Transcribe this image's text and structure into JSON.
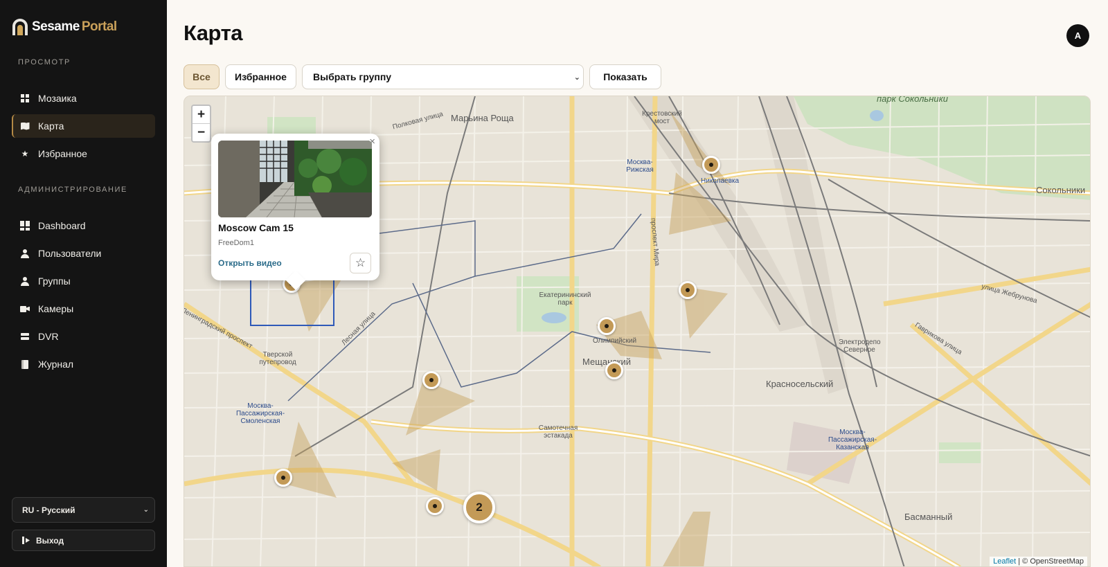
{
  "brand": {
    "name_a": "Sesame",
    "name_b": "Portal"
  },
  "sidebar": {
    "section_view": "ПРОСМОТР",
    "section_admin": "АДМИНИСТРИРОВАНИЕ",
    "view_items": [
      {
        "label": "Мозаика",
        "icon": "grid-icon"
      },
      {
        "label": "Карта",
        "icon": "map-icon",
        "active": true
      },
      {
        "label": "Избранное",
        "icon": "star-icon"
      }
    ],
    "admin_items": [
      {
        "label": "Dashboard",
        "icon": "dashboard-icon"
      },
      {
        "label": "Пользователи",
        "icon": "user-icon"
      },
      {
        "label": "Группы",
        "icon": "users-icon"
      },
      {
        "label": "Камеры",
        "icon": "camera-icon"
      },
      {
        "label": "DVR",
        "icon": "dvr-icon"
      },
      {
        "label": "Журнал",
        "icon": "journal-icon"
      }
    ],
    "language": "RU - Русский",
    "logout": "Выход"
  },
  "header": {
    "title": "Карта",
    "avatar_initial": "A"
  },
  "toolbar": {
    "all_label": "Все",
    "favorites_label": "Избранное",
    "group_select": "Выбрать группу",
    "show_label": "Показать"
  },
  "map": {
    "zoom_in": "+",
    "zoom_out": "−",
    "cluster_count": "2",
    "attribution_link": "Leaflet",
    "attribution_text": " | © OpenStreetMap",
    "labels": {
      "maryina": "Марьина Роща",
      "krest": "Крестовский мост",
      "sokolniki_park": "парк Сокольники",
      "sokolniki": "Сокольники",
      "rizhskaya": "Москва-Рижская",
      "nikolaevka": "Николаевка",
      "prospekt_mira": "проспект Мира",
      "ekaterin": "Екатерининский парк",
      "olympic": "Олимпийский",
      "meshchansky": "Мещанский",
      "tverskoy": "Тверской путепровод",
      "smolenskaya": "Москва-Пассажирская-Смоленская",
      "samotechnaya": "Самотечная эстакада",
      "krasnoselsky": "Красносельский",
      "kazanskaya": "Москва-Пассажирская-Казанская",
      "basmanny": "Басманный",
      "leningradsky": "Ленинградский проспект",
      "lesnaya": "Лесная улица",
      "polkovaya": "Полковая улица",
      "gavrikova": "Гаврикова улица",
      "zhebrunova": "улица Жебрунова",
      "elektrodepo": "Электродепо Северное"
    }
  },
  "popup": {
    "title": "Moscow Cam 15",
    "subtitle": "FreeDom1",
    "open_video": "Открыть видео",
    "close": "×",
    "star": "☆"
  },
  "colors": {
    "sidebar_bg": "#141414",
    "accent": "#c39a57",
    "active_bg": "#2a241b",
    "page_bg": "#fbf8f3"
  }
}
